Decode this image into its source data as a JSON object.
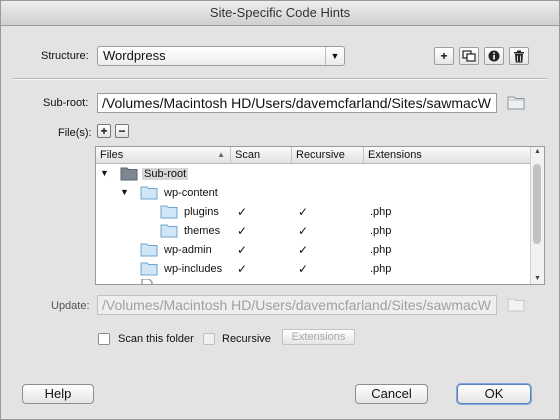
{
  "window": {
    "title": "Site-Specific Code Hints"
  },
  "structure": {
    "label": "Structure:",
    "value": "Wordpress",
    "toolbar": [
      {
        "name": "add-structure-icon",
        "glyph": "+"
      },
      {
        "name": "duplicate-structure-icon",
        "glyph": "⧉"
      },
      {
        "name": "info-icon",
        "glyph": "i"
      },
      {
        "name": "trash-icon",
        "glyph": "🗑"
      }
    ]
  },
  "subroot": {
    "label": "Sub-root:",
    "value": "/Volumes/Macintosh HD/Users/davemcfarland/Sites/sawmacW"
  },
  "files": {
    "label": "File(s):",
    "add": "+",
    "remove": "−",
    "columns": [
      "Files",
      "Scan",
      "Recursive",
      "Extensions"
    ],
    "rows": [
      {
        "name": "Sub-root",
        "scan": "",
        "recursive": "",
        "ext": ""
      },
      {
        "name": "wp-content",
        "scan": "",
        "recursive": "",
        "ext": ""
      },
      {
        "name": "plugins",
        "scan": "✓",
        "recursive": "✓",
        "ext": ".php"
      },
      {
        "name": "themes",
        "scan": "✓",
        "recursive": "✓",
        "ext": ".php"
      },
      {
        "name": "wp-admin",
        "scan": "✓",
        "recursive": "✓",
        "ext": ".php"
      },
      {
        "name": "wp-includes",
        "scan": "✓",
        "recursive": "✓",
        "ext": ".php"
      }
    ]
  },
  "update": {
    "label": "Update:",
    "value": "/Volumes/Macintosh HD/Users/davemcfarland/Sites/sawmacW"
  },
  "options": {
    "scan_label": "Scan this folder",
    "recursive_label": "Recursive",
    "extensions_label": "Extensions"
  },
  "buttons": {
    "help": "Help",
    "cancel": "Cancel",
    "ok": "OK"
  }
}
